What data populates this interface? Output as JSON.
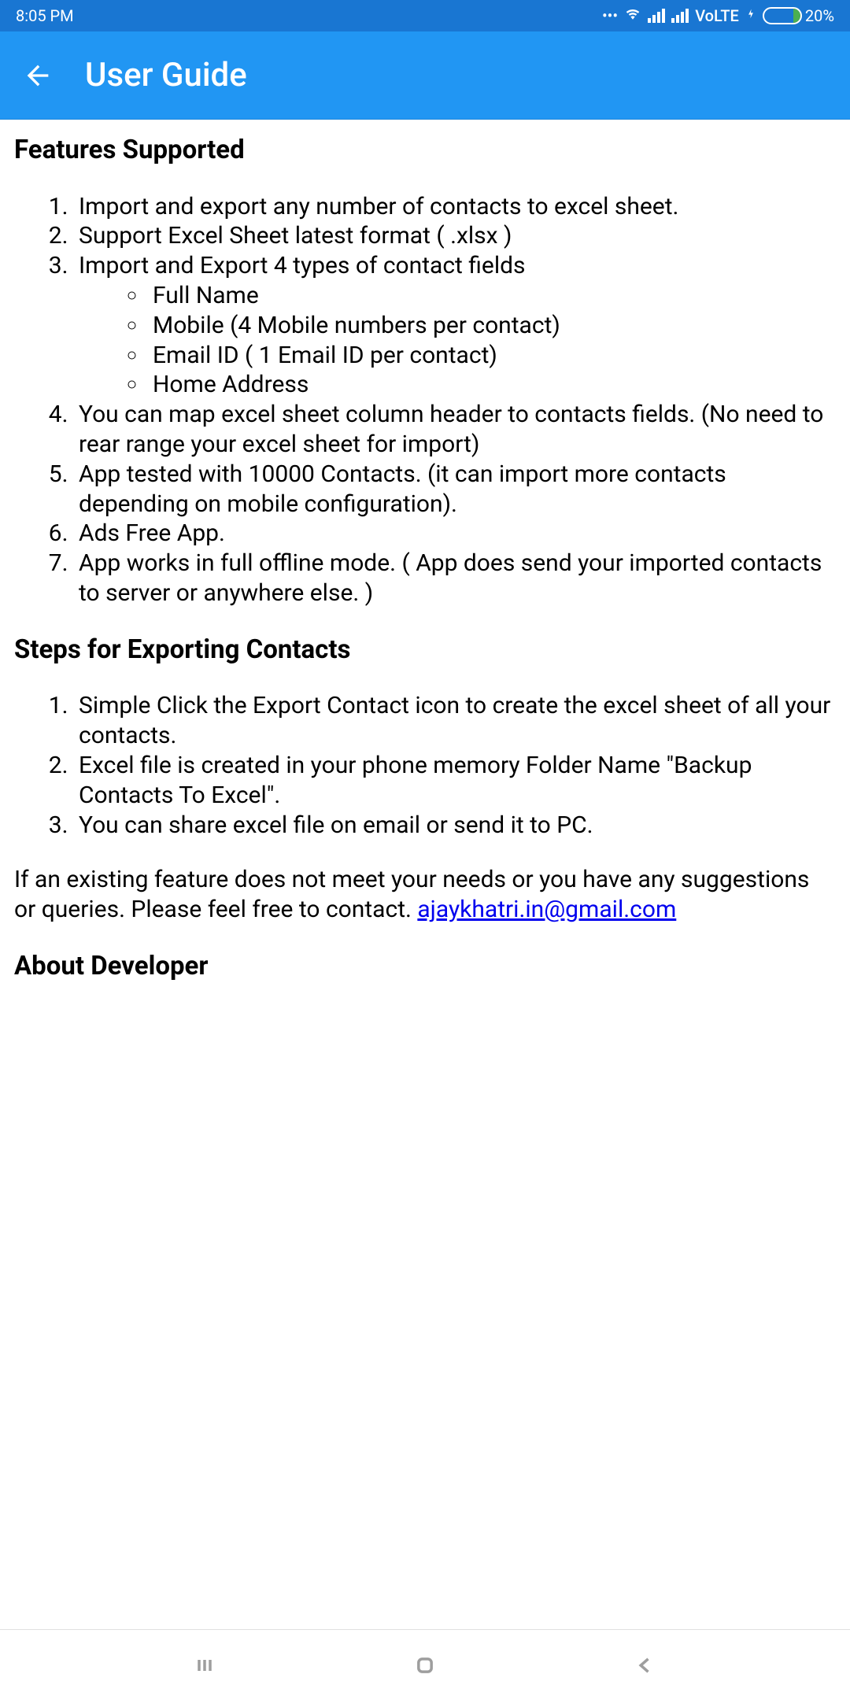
{
  "status": {
    "time": "8:05 PM",
    "volte": "VoLTE",
    "battery_pct": "20%"
  },
  "header": {
    "title": "User Guide"
  },
  "sections": {
    "features_heading": "Features Supported",
    "features": {
      "item1": "Import and export any number of contacts to excel sheet.",
      "item2": "Support Excel Sheet latest format ( .xlsx )",
      "item3": "Import and Export 4 types of contact fields",
      "item3_sub": {
        "a": "Full Name",
        "b": "Mobile (4 Mobile numbers per contact)",
        "c": "Email ID ( 1 Email ID per contact)",
        "d": "Home Address"
      },
      "item4": "You can map excel sheet column header to contacts fields. (No need to rear range your excel sheet for import)",
      "item5": "App tested with 10000 Contacts. (it can import more contacts depending on mobile configuration).",
      "item6": "Ads Free App.",
      "item7": "App works in full offline mode. (  App does send your imported contacts to server or anywhere else. )"
    },
    "export_heading": "Steps for Exporting Contacts",
    "export_steps": {
      "item1": "Simple Click the Export Contact icon to create the excel sheet of all your contacts.",
      "item2": "Excel file is created in your phone memory Folder Name \"Backup Contacts To Excel\".",
      "item3": "You can share excel file on email or send it to PC."
    },
    "contact_text": "If an existing feature does not meet your needs or you have any suggestions or queries. Please feel free to contact. ",
    "contact_email": "ajaykhatri.in@gmail.com",
    "about_heading": "About Developer"
  }
}
